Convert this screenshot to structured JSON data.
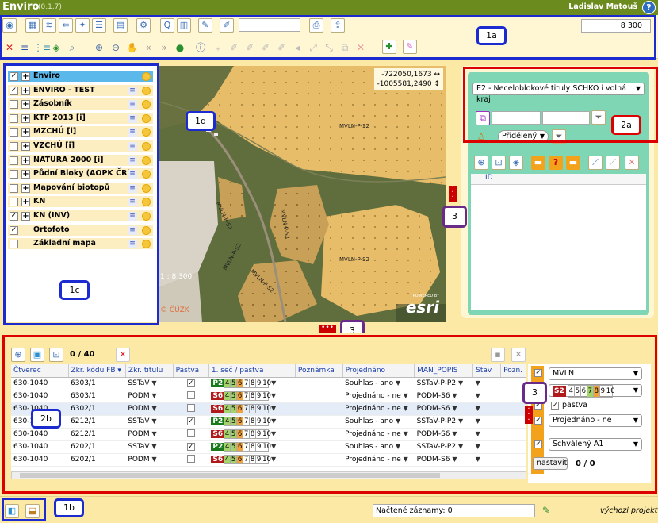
{
  "app": {
    "title": "Enviro",
    "version": "(0.1.7)",
    "user": "Ladislav Matouš",
    "help": "?"
  },
  "toolbar": {
    "scale_value": "8 300"
  },
  "callouts": {
    "c1a": "1a",
    "c1b": "1b",
    "c1c": "1c",
    "c1d": "1d",
    "c2a": "2a",
    "c2b": "2b",
    "c3a": "3",
    "c3b": "3",
    "c3c": "3"
  },
  "map": {
    "coord_x": "-722050,1673 ↔",
    "coord_y": "-1005581,2490 ↕",
    "scale": "1 : 8 300",
    "attribution": "© ČÚZK",
    "esri_powered": "POWERED BY",
    "esri": "esri",
    "labels": [
      "MVLN-P-S2",
      "MVLN-P-S2",
      "MVLN-P-S2",
      "MVLN-P-S2",
      "MVLN-P-S2",
      "MVLN-P-S2"
    ]
  },
  "layers": [
    {
      "name": "Enviro",
      "checked": true,
      "expand": true,
      "selected": true
    },
    {
      "name": "ENVIRO - TEST",
      "checked": true,
      "expand": true
    },
    {
      "name": "Zásobník",
      "checked": false,
      "expand": true
    },
    {
      "name": "KTP 2013 [i]",
      "checked": false,
      "expand": true
    },
    {
      "name": "MZCHÚ [i]",
      "checked": false,
      "expand": true
    },
    {
      "name": "VZCHÚ [i]",
      "checked": false,
      "expand": true
    },
    {
      "name": "NATURA 2000 [i]",
      "checked": false,
      "expand": true
    },
    {
      "name": "Půdní Bloky (AOPK ČR)",
      "checked": false,
      "expand": true
    },
    {
      "name": "Mapování biotopů",
      "checked": false,
      "expand": true
    },
    {
      "name": "KN",
      "checked": false,
      "expand": true
    },
    {
      "name": "KN (INV)",
      "checked": true,
      "expand": true
    },
    {
      "name": "Ortofoto",
      "checked": true,
      "expand": false
    },
    {
      "name": "Základní mapa",
      "checked": false,
      "expand": false
    }
  ],
  "panel2": {
    "select": "E2 - Neceloblokové tituly SCHKO i volná kraj",
    "assigned": "Přidělený",
    "id_header": "ID"
  },
  "grid": {
    "count": "0 / 40",
    "columns": [
      "Čtverec",
      "Zkr. kódu FB ▾",
      "Zkr. titulu",
      "Pastva",
      "1. seč / pastva",
      "Poznámka",
      "Projednáno",
      "MAN_POPIS",
      "Stav",
      "Pozn."
    ],
    "rows": [
      {
        "ctverec": "630-1040",
        "fb": "6303/1",
        "titul": "SSTaV",
        "pastva": true,
        "sec": "P2",
        "proj": "Souhlas - ano",
        "man": "SSTaV-P-P2"
      },
      {
        "ctverec": "630-1040",
        "fb": "6303/1",
        "titul": "PODM",
        "pastva": false,
        "sec": "S6",
        "proj": "Projednáno - ne",
        "man": "PODM-S6"
      },
      {
        "ctverec": "630-1040",
        "fb": "6302/1",
        "titul": "PODM",
        "pastva": false,
        "sec": "S6",
        "proj": "Projednáno - ne",
        "man": "PODM-S6"
      },
      {
        "ctverec": "630-1040",
        "fb": "6212/1",
        "titul": "SSTaV",
        "pastva": true,
        "sec": "P2",
        "proj": "Souhlas - ano",
        "man": "SSTaV-P-P2"
      },
      {
        "ctverec": "630-1040",
        "fb": "6212/1",
        "titul": "PODM",
        "pastva": false,
        "sec": "S6",
        "proj": "Projednáno - ne",
        "man": "PODM-S6"
      },
      {
        "ctverec": "630-1040",
        "fb": "6202/1",
        "titul": "SSTaV",
        "pastva": true,
        "sec": "P2",
        "proj": "Souhlas - ano",
        "man": "SSTaV-P-P2"
      },
      {
        "ctverec": "630-1040",
        "fb": "6202/1",
        "titul": "PODM",
        "pastva": false,
        "sec": "S6",
        "proj": "Projednáno - ne",
        "man": "PODM-S6"
      }
    ],
    "digits": [
      "4",
      "5",
      "6",
      "7",
      "8",
      "9",
      "10"
    ]
  },
  "filter": {
    "mvln": "MVLN",
    "sec": "S2",
    "pastva_label": "pastva",
    "projednano": "Projednáno - ne",
    "schvaleny": "Schválený A1",
    "nastavit": "nastavit",
    "count": "0 / 0"
  },
  "footer": {
    "records": "Načtené záznamy: 0",
    "project": "výchozí projekt"
  }
}
